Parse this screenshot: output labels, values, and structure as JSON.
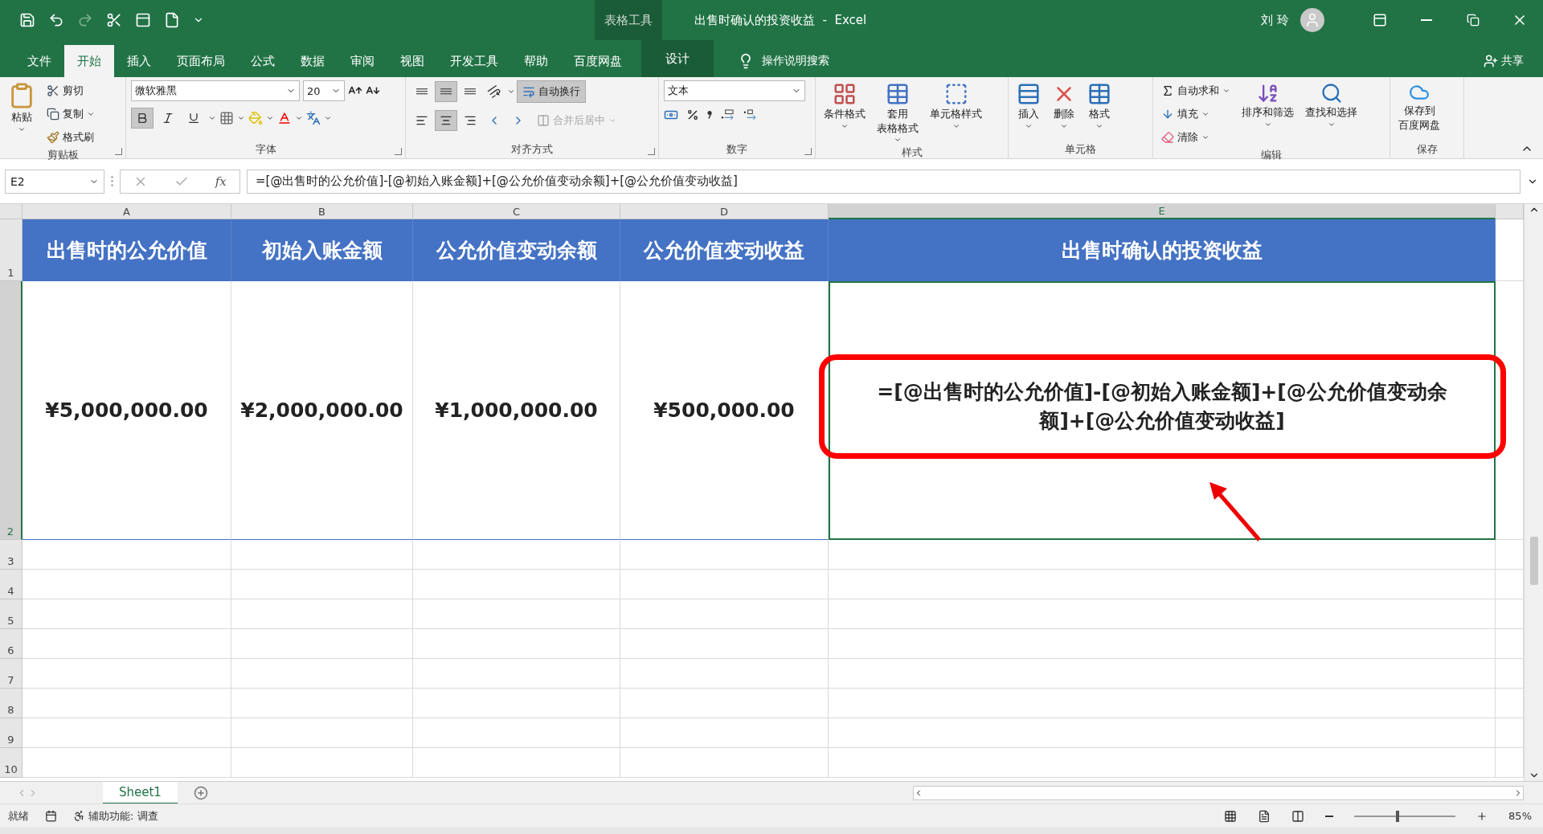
{
  "window": {
    "context_label": "表格工具",
    "title": "出售时确认的投资收益  -  Excel",
    "user": "刘 玲"
  },
  "menu_tabs": [
    {
      "label": "文件",
      "selected": false,
      "kind": "file"
    },
    {
      "label": "开始",
      "selected": true,
      "kind": "normal"
    },
    {
      "label": "插入",
      "selected": false,
      "kind": "normal"
    },
    {
      "label": "页面布局",
      "selected": false,
      "kind": "normal"
    },
    {
      "label": "公式",
      "selected": false,
      "kind": "normal"
    },
    {
      "label": "数据",
      "selected": false,
      "kind": "normal"
    },
    {
      "label": "审阅",
      "selected": false,
      "kind": "normal"
    },
    {
      "label": "视图",
      "selected": false,
      "kind": "normal"
    },
    {
      "label": "开发工具",
      "selected": false,
      "kind": "normal"
    },
    {
      "label": "帮助",
      "selected": false,
      "kind": "normal"
    },
    {
      "label": "百度网盘",
      "selected": false,
      "kind": "normal"
    },
    {
      "label": "设计",
      "selected": false,
      "kind": "contextual"
    }
  ],
  "tell_me": "操作说明搜索",
  "share": "共享",
  "ribbon": {
    "clipboard": {
      "title": "剪贴板",
      "paste": "粘贴",
      "cut": "剪切",
      "copy": "复制",
      "format_painter": "格式刷"
    },
    "font": {
      "title": "字体",
      "font_name": "微软雅黑",
      "font_size": "20",
      "bold": true,
      "italic": false,
      "underline": false
    },
    "alignment": {
      "title": "对齐方式",
      "wrap_text": "自动换行",
      "wrap_on": true,
      "merge_center": "合并后居中",
      "merge_disabled": true,
      "middle_align": true,
      "center_align": true
    },
    "number": {
      "title": "数字",
      "format": "文本"
    },
    "styles": {
      "title": "样式",
      "buttons": [
        {
          "lines": [
            "条件格式"
          ]
        },
        {
          "lines": [
            "套用",
            "表格格式"
          ]
        },
        {
          "lines": [
            "单元格样式"
          ]
        }
      ]
    },
    "cells": {
      "title": "单元格",
      "buttons": [
        {
          "lines": [
            "插入"
          ]
        },
        {
          "lines": [
            "删除"
          ]
        },
        {
          "lines": [
            "格式"
          ]
        }
      ]
    },
    "editing": {
      "title": "编辑",
      "autosum": "自动求和",
      "fill": "填充",
      "clear": "清除",
      "sort_filter": "排序和筛选",
      "find_select": "查找和选择"
    },
    "save": {
      "title": "保存",
      "lines": [
        "保存到",
        "百度网盘"
      ]
    }
  },
  "formula_bar": {
    "name_box": "E2",
    "function_label": "fx",
    "formula": "=[@出售时的公允价值]-[@初始入账金额]+[@公允价值变动余额]+[@公允价值变动收益]"
  },
  "sheet": {
    "columns": [
      {
        "label": "A",
        "selected": false
      },
      {
        "label": "B",
        "selected": false
      },
      {
        "label": "C",
        "selected": false
      },
      {
        "label": "D",
        "selected": false
      },
      {
        "label": "E",
        "selected": true
      }
    ],
    "row_numbers": [
      {
        "label": "1",
        "selected": false
      },
      {
        "label": "2",
        "selected": true
      },
      {
        "label": "3",
        "selected": false
      },
      {
        "label": "4",
        "selected": false
      },
      {
        "label": "5",
        "selected": false
      },
      {
        "label": "6",
        "selected": false
      },
      {
        "label": "7",
        "selected": false
      },
      {
        "label": "8",
        "selected": false
      },
      {
        "label": "9",
        "selected": false
      },
      {
        "label": "10",
        "selected": false
      }
    ],
    "header_row": [
      "出售时的公允价值",
      "初始入账金额",
      "公允价值变动余额",
      "公允价值变动收益",
      "出售时确认的投资收益"
    ],
    "data_row": [
      "¥5,000,000.00",
      "¥2,000,000.00",
      "¥1,000,000.00",
      "¥500,000.00",
      "=[@出售时的公允价值]-[@初始入账金额]+[@公允价值变动余额]+[@公允价值变动收益]"
    ],
    "annotation": {
      "kind": "box_and_arrow"
    }
  },
  "sheet_tabs": [
    {
      "label": "Sheet1",
      "selected": true
    }
  ],
  "status_bar": {
    "ready": "就绪",
    "accessibility": "辅助功能: 调查",
    "zoom": "85%",
    "zoom_level": {
      "level": 0.43
    }
  }
}
